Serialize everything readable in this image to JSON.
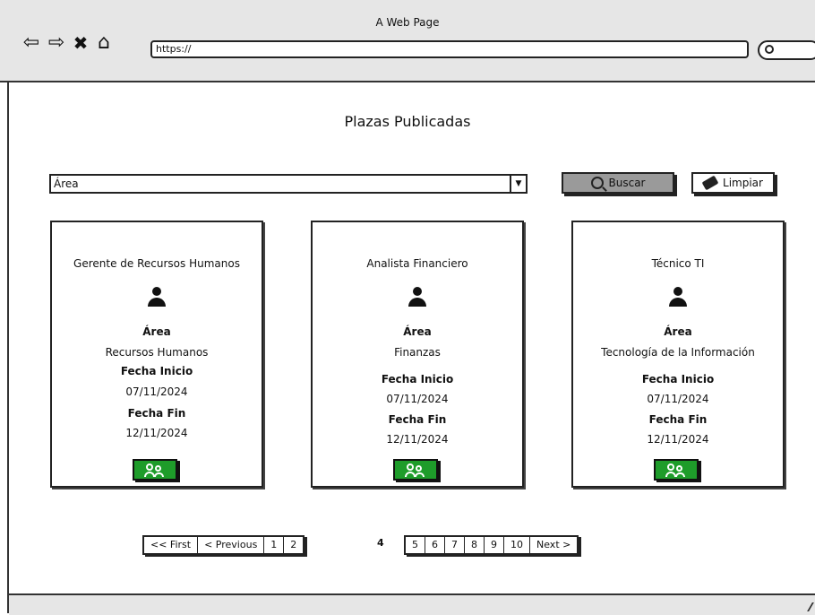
{
  "window": {
    "title": "A Web Page"
  },
  "toolbar": {
    "back_icon": "arrow-left-icon",
    "forward_icon": "arrow-right-icon",
    "close_icon": "close-icon",
    "home_icon": "home-icon",
    "url": "https://"
  },
  "page": {
    "title": "Plazas Publicadas"
  },
  "filter": {
    "area_select_value": "Área",
    "search_button": "Buscar",
    "clear_button": "Limpiar"
  },
  "cards": [
    {
      "title": "Gerente de Recursos Humanos",
      "area_label": "Área",
      "area": "Recursos Humanos",
      "start_label": "Fecha Inicio",
      "start_date": "07/11/2024",
      "end_label": "Fecha Fin",
      "end_date": "12/11/2024"
    },
    {
      "title": "Analista Financiero",
      "area_label": "Área",
      "area": "Finanzas",
      "start_label": "Fecha Inicio",
      "start_date": "07/11/2024",
      "end_label": "Fecha Fin",
      "end_date": "12/11/2024"
    },
    {
      "title": "Técnico TI",
      "area_label": "Área",
      "area": "Tecnología de la Información",
      "start_label": "Fecha Inicio",
      "start_date": "07/11/2024",
      "end_label": "Fecha Fin",
      "end_date": "12/11/2024"
    }
  ],
  "pagination": {
    "first": "<< First",
    "previous": "< Previous",
    "pages_before": [
      "1",
      "2"
    ],
    "current": "4",
    "pages_after": [
      "5",
      "6",
      "7",
      "8",
      "9",
      "10"
    ],
    "next": "Next >"
  },
  "colors": {
    "accent_green": "#1e9c2a",
    "search_button_bg": "#9a9a9a"
  }
}
